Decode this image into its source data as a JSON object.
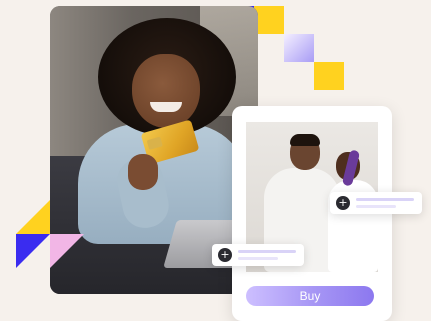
{
  "product_card": {
    "buy_label": "Buy"
  },
  "tags": [
    {
      "icon": "plus-icon"
    },
    {
      "icon": "plus-icon"
    }
  ],
  "colors": {
    "brand_blue": "#3a2cf0",
    "brand_yellow": "#ffd21f",
    "brand_lavender": "#a89cf5",
    "brand_pink": "#f2b6e6",
    "background": "#f6f1ec"
  }
}
